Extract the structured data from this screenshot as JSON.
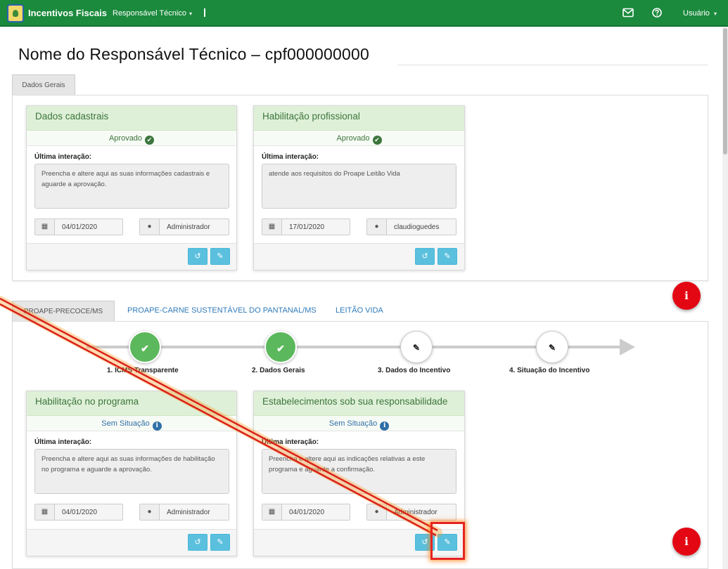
{
  "topbar": {
    "brand": "Incentivos Fiscais",
    "menu_label": "Responsável Técnico",
    "menu_caret": "▾",
    "user_label": "Usuário",
    "user_caret": "▾"
  },
  "page_title": "Nome do Responsável Técnico – cpf000000000",
  "general_section": {
    "tab_label": "Dados Gerais",
    "cards": [
      {
        "title": "Dados cadastrais",
        "status": "Aprovado",
        "last_label": "Última interação:",
        "note": "Preencha e altere aqui as suas informações cadastrais e aguarde a aprovação.",
        "date": "04/01/2020",
        "user": "Administrador"
      },
      {
        "title": "Habilitação profissional",
        "status": "Aprovado",
        "last_label": "Última interação:",
        "note": "atende aos requisitos do Proape Leitão Vida",
        "date": "17/01/2020",
        "user": "claudioguedes"
      }
    ]
  },
  "program_section": {
    "tabs": [
      "PROAPE-PRECOCE/MS",
      "PROAPE-CARNE SUSTENTÁVEL DO PANTANAL/MS",
      "LEITÃO VIDA"
    ],
    "steps": [
      {
        "label": "1. ICMS Transparente",
        "state": "done"
      },
      {
        "label": "2. Dados Gerais",
        "state": "done"
      },
      {
        "label": "3. Dados do Incentivo",
        "state": "edit"
      },
      {
        "label": "4. Situação do Incentivo",
        "state": "edit"
      }
    ],
    "cards": [
      {
        "title": "Habilitação no programa",
        "status": "Sem Situação",
        "last_label": "Última interação:",
        "note": "Preencha e altere aqui as suas informações de habilitação no programa e aguarde a aprovação.",
        "date": "04/01/2020",
        "user": "Administrador"
      },
      {
        "title": "Estabelecimentos sob sua responsabilidade",
        "status": "Sem Situação",
        "last_label": "Última interação:",
        "note": "Preencha e altere aqui as indicações relativas a este programa e aguarde a confirmação.",
        "date": "04/01/2020",
        "user": "Administrador"
      }
    ]
  },
  "fab_label": "i",
  "colors": {
    "topbar": "#1b8a3d",
    "card_header": "#dff0d8",
    "button": "#5bc0de",
    "fab": "#e30613",
    "highlight": "#e52421"
  },
  "icons": {
    "envelope": "envelope-icon",
    "help": "question-circle-icon",
    "calendar": "calendar-icon",
    "user": "user-icon",
    "history": "history-icon",
    "edit": "pencil-icon",
    "check": "check-circle-icon",
    "info": "info-circle-icon"
  }
}
